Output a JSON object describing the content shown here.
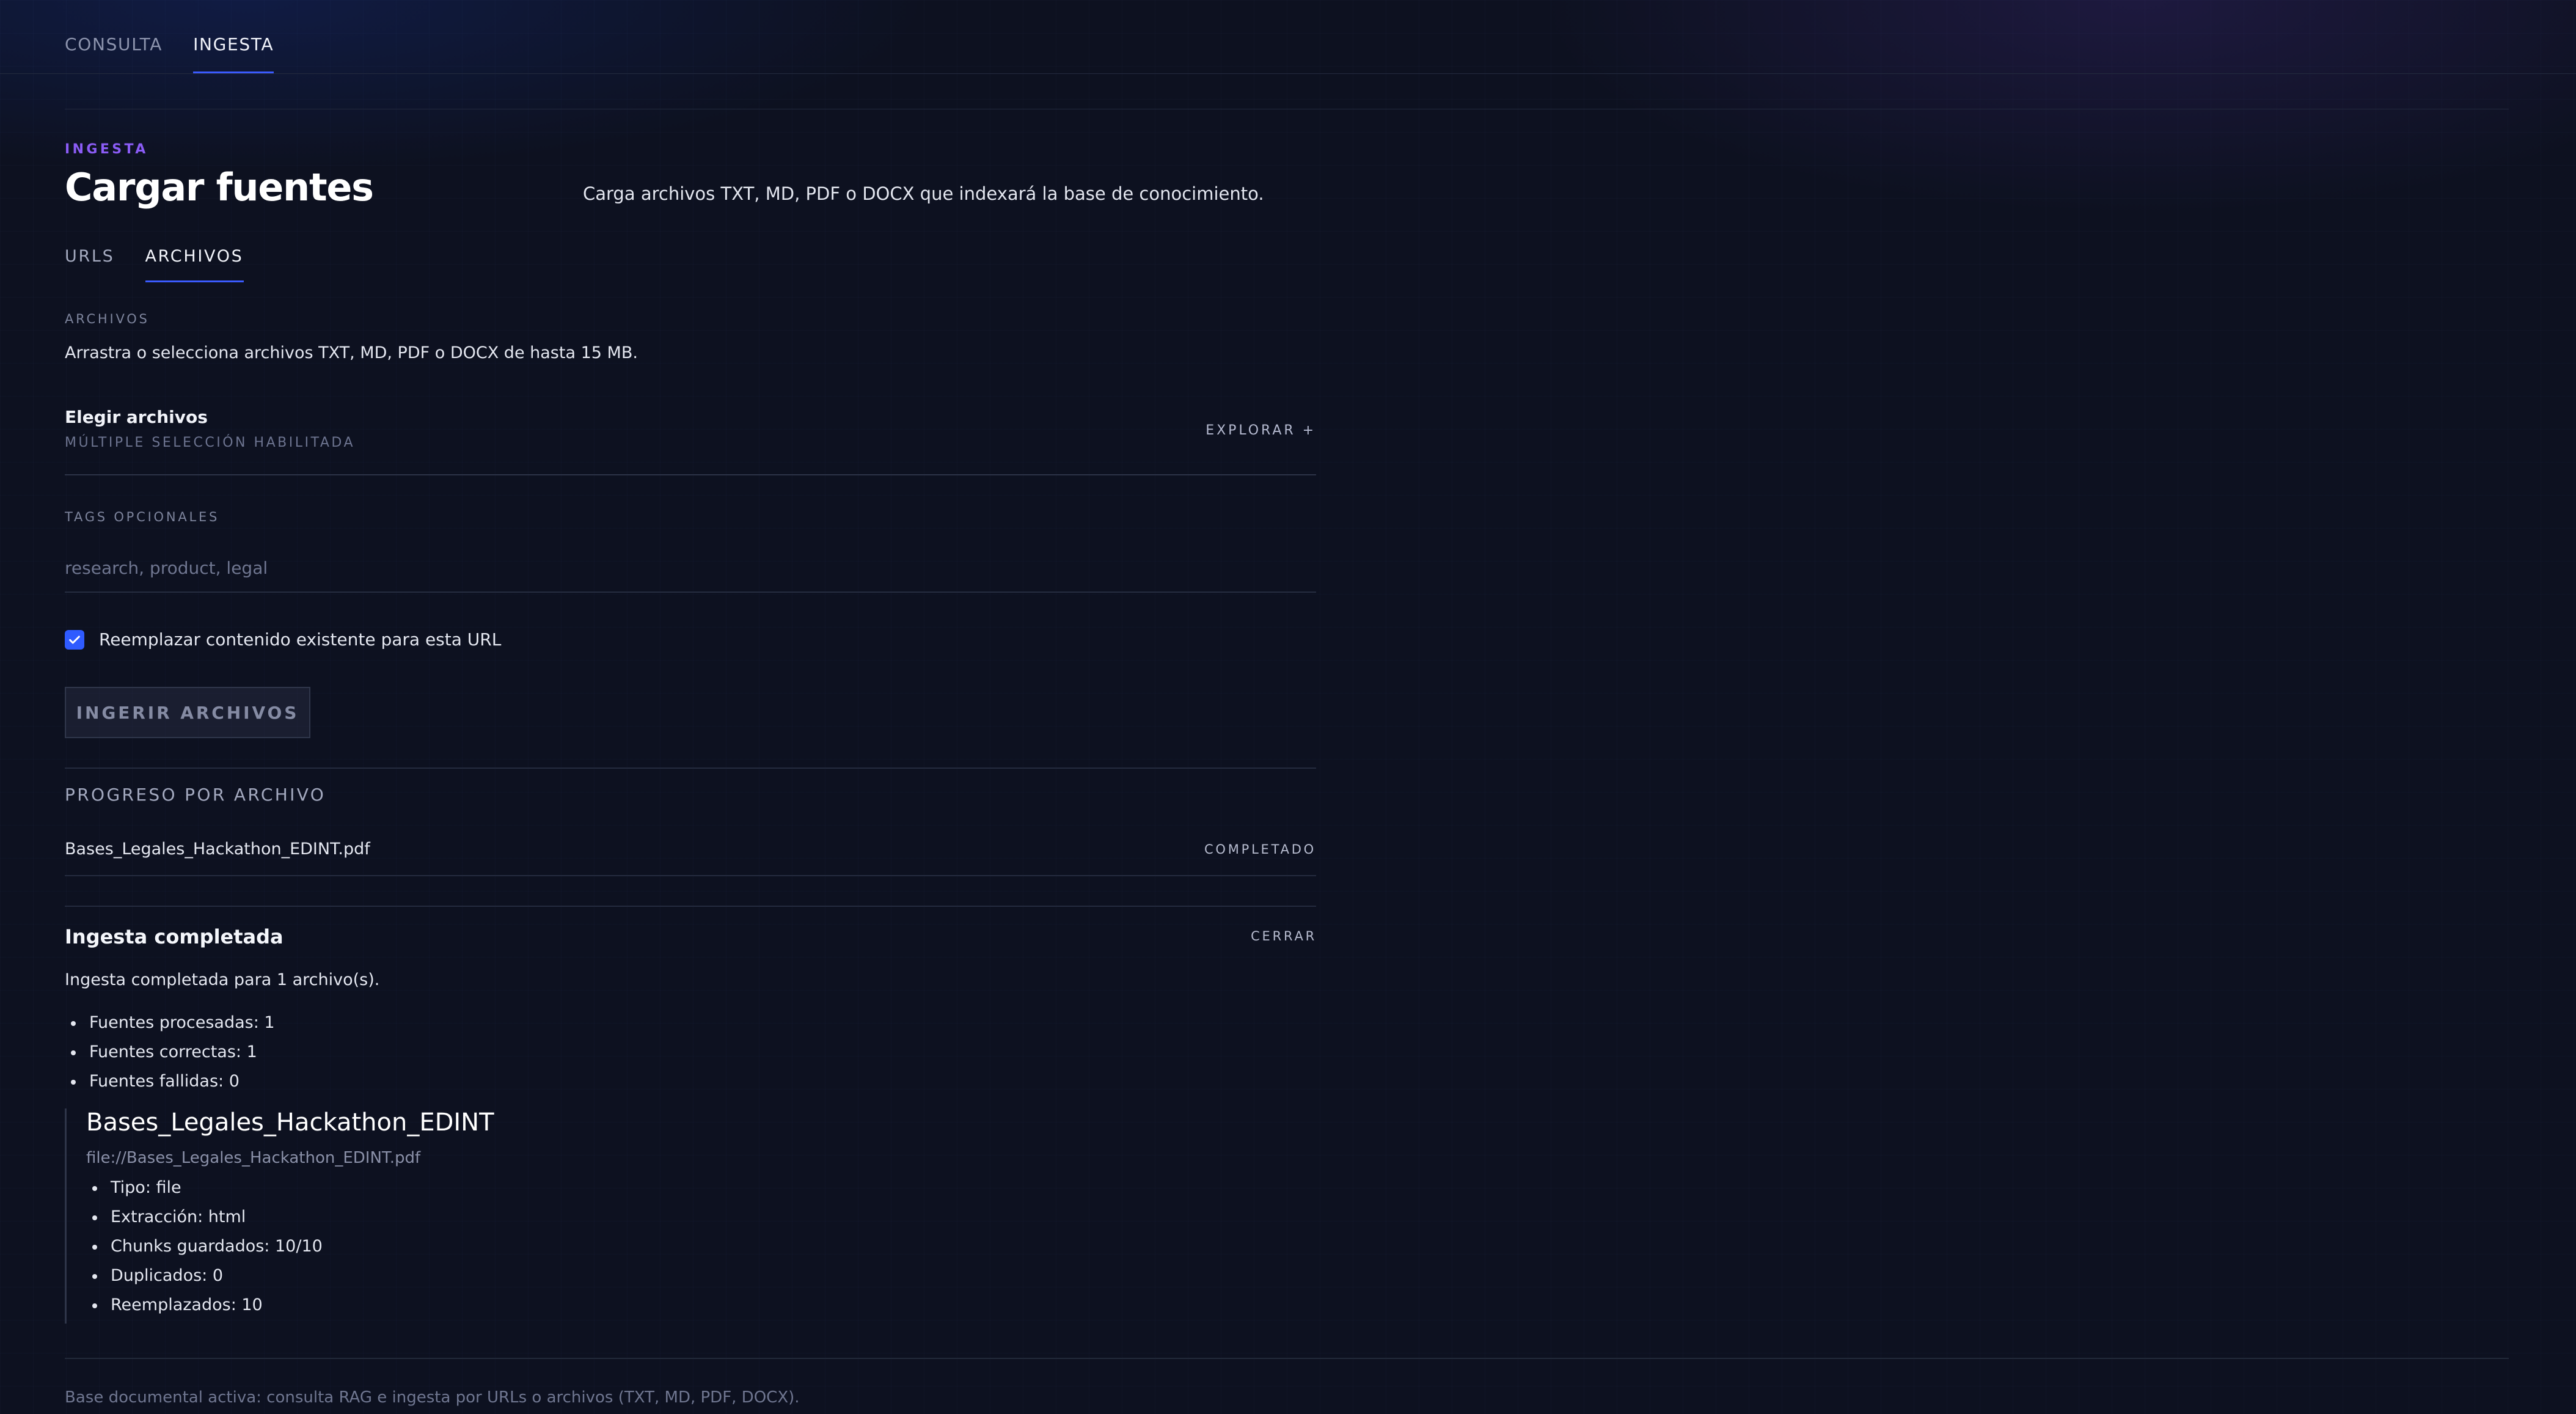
{
  "nav": {
    "tabs": [
      {
        "label": "CONSULTA",
        "active": false
      },
      {
        "label": "INGESTA",
        "active": true
      }
    ]
  },
  "header": {
    "eyebrow": "INGESTA",
    "title": "Cargar fuentes",
    "description": "Carga archivos TXT, MD, PDF o DOCX que indexará la base de conocimiento."
  },
  "subtabs": [
    {
      "label": "URLS",
      "active": false
    },
    {
      "label": "ARCHIVOS",
      "active": true
    }
  ],
  "files_section": {
    "label": "ARCHIVOS",
    "description": "Arrastra o selecciona archivos TXT, MD, PDF o DOCX de hasta 15 MB.",
    "picker_title": "Elegir archivos",
    "picker_hint": "MÚLTIPLE SELECCIÓN HABILITADA",
    "browse_label": "EXPLORAR +"
  },
  "tags": {
    "label": "TAGS OPCIONALES",
    "placeholder": "research, product, legal",
    "value": ""
  },
  "replace_option": {
    "label": "Reemplazar contenido existente para esta URL",
    "checked": true
  },
  "ingest_button_label": "INGERIR ARCHIVOS",
  "progress": {
    "title": "PROGRESO POR ARCHIVO",
    "files": [
      {
        "name": "Bases_Legales_Hackathon_EDINT.pdf",
        "status": "COMPLETADO"
      }
    ]
  },
  "result": {
    "title": "Ingesta completada",
    "close_label": "CERRAR",
    "summary": "Ingesta completada para 1 archivo(s).",
    "stats": [
      "Fuentes procesadas: 1",
      "Fuentes correctas: 1",
      "Fuentes fallidas: 0"
    ],
    "sources": [
      {
        "name": "Bases_Legales_Hackathon_EDINT",
        "uri": "file://Bases_Legales_Hackathon_EDINT.pdf",
        "details": [
          "Tipo: file",
          "Extracción: html",
          "Chunks guardados: 10/10",
          "Duplicados: 0",
          "Reemplazados: 10"
        ]
      }
    ]
  },
  "footer": {
    "text": "Base documental activa: consulta RAG e ingesta por URLs o archivos (TXT, MD, PDF, DOCX)."
  },
  "colors": {
    "accent": "#3b5bff",
    "eyebrow": "#8b5cf6",
    "background": "#0d1120"
  }
}
